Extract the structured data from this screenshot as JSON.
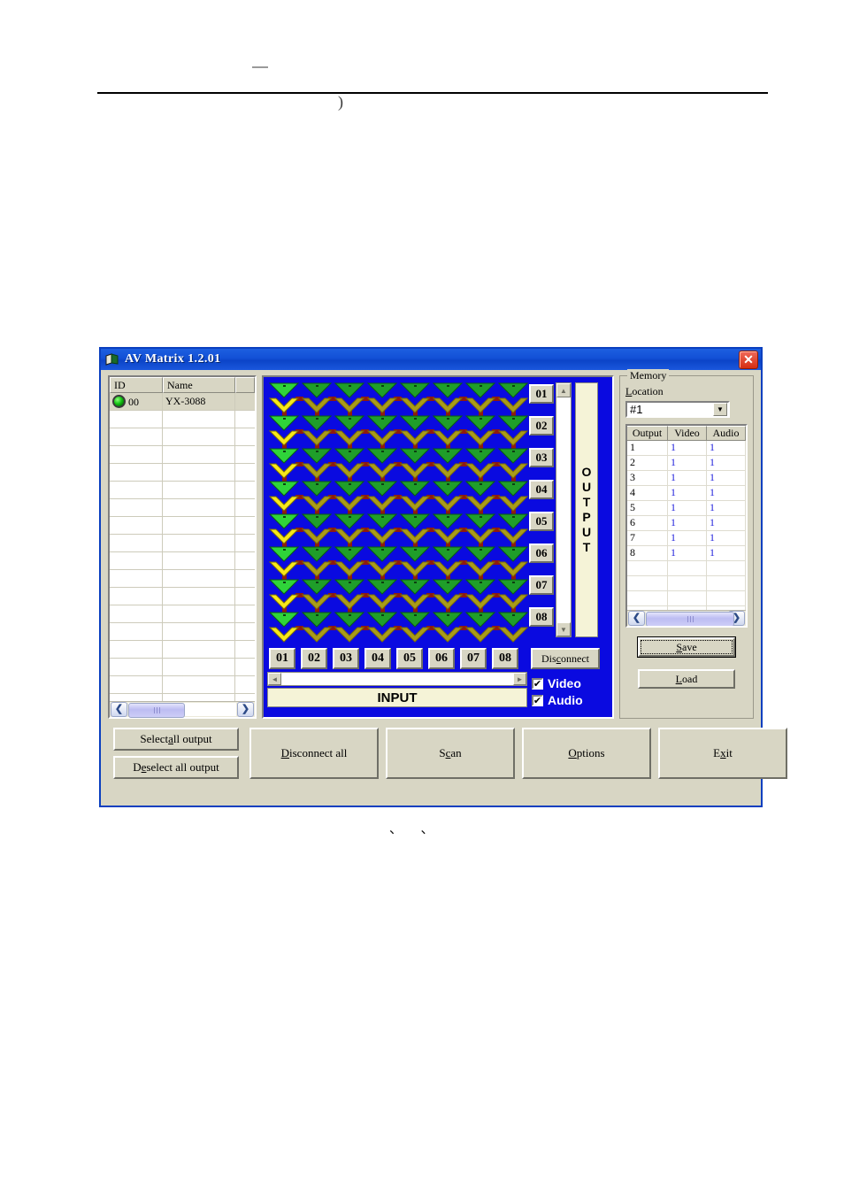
{
  "page": {
    "paren": ")",
    "caption": "、、"
  },
  "window": {
    "title": "AV Matrix 1.2.01",
    "close_label": "✕",
    "icon": "window-app-icon"
  },
  "device_list": {
    "columns": [
      "ID",
      "Name",
      ""
    ],
    "rows": [
      {
        "id": "00",
        "name": "YX-3088",
        "status": "online",
        "selected": true
      }
    ],
    "empty_row_count": 17,
    "scrollbar": {
      "left_arrow": "❮",
      "right_arrow": "❯"
    }
  },
  "matrix": {
    "rows": 8,
    "cols": 8,
    "output_buttons": [
      "01",
      "02",
      "03",
      "04",
      "05",
      "06",
      "07",
      "08"
    ],
    "input_buttons": [
      "01",
      "02",
      "03",
      "04",
      "05",
      "06",
      "07",
      "08"
    ],
    "output_label": "OUTPUT",
    "input_label": "INPUT",
    "selected_column": 1,
    "disconnect_label_pre": "Dis",
    "disconnect_label_key": "c",
    "disconnect_label_post": "onnect",
    "video_checkbox": {
      "label": "Video",
      "checked": true,
      "mark": "✔"
    },
    "audio_checkbox": {
      "label": "Audio",
      "checked": true,
      "mark": "✔"
    },
    "scroll_up": "▲",
    "scroll_down": "▼",
    "scroll_left": "◄",
    "scroll_right": "►",
    "colors": {
      "panel_bg": "#0a0ae0",
      "link": "#8f1a10",
      "video_tri_on": "#2fd43a",
      "video_tri_off": "#1f9e2a",
      "audio_v_on": "#f7e71b",
      "audio_v_off": "#a99b1a"
    }
  },
  "memory": {
    "group_title": "Memory",
    "location_label_pre": "",
    "location_label_key": "L",
    "location_label_post": "ocation",
    "location_value": "#1",
    "combo_arrow": "▼",
    "table": {
      "columns": [
        "Output",
        "Video",
        "Audio"
      ],
      "rows": [
        {
          "output": "1",
          "video": "1",
          "audio": "1"
        },
        {
          "output": "2",
          "video": "1",
          "audio": "1"
        },
        {
          "output": "3",
          "video": "1",
          "audio": "1"
        },
        {
          "output": "4",
          "video": "1",
          "audio": "1"
        },
        {
          "output": "5",
          "video": "1",
          "audio": "1"
        },
        {
          "output": "6",
          "video": "1",
          "audio": "1"
        },
        {
          "output": "7",
          "video": "1",
          "audio": "1"
        },
        {
          "output": "8",
          "video": "1",
          "audio": "1"
        }
      ],
      "empty_row_count": 5,
      "scrollbar": {
        "left_arrow": "❮",
        "right_arrow": "❯"
      }
    },
    "save": {
      "pre": "",
      "key": "S",
      "post": "ave",
      "focused": true
    },
    "load": {
      "pre": "",
      "key": "L",
      "post": "oad",
      "focused": false
    }
  },
  "bottom_bar": {
    "select_all": {
      "pre": "Select ",
      "key": "a",
      "post": "ll output"
    },
    "deselect_all": {
      "pre": "D",
      "key": "e",
      "post": "select all output"
    },
    "disconnect_all": {
      "pre": "",
      "key": "D",
      "post": "isconnect all"
    },
    "scan": {
      "pre": "S",
      "key": "c",
      "post": "an"
    },
    "options": {
      "pre": "",
      "key": "O",
      "post": "ptions"
    },
    "exit": {
      "pre": "E",
      "key": "x",
      "post": "it"
    }
  }
}
